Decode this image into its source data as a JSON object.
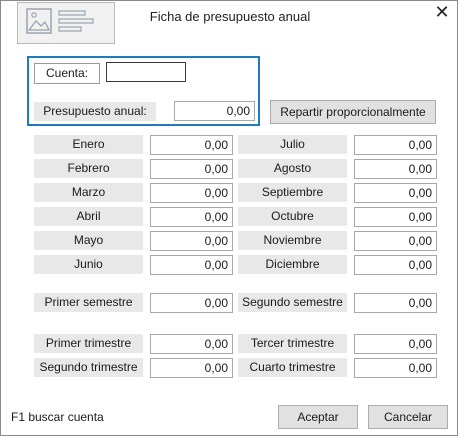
{
  "window": {
    "title": "Ficha de presupuesto anual",
    "close_glyph": "✕"
  },
  "cuenta": {
    "label": "Cuenta:",
    "value": ""
  },
  "presupuesto": {
    "label": "Presupuesto anual:",
    "value": "0,00"
  },
  "repartir_button": "Repartir proporcionalmente",
  "months": [
    {
      "label": "Enero",
      "value": "0,00"
    },
    {
      "label": "Febrero",
      "value": "0,00"
    },
    {
      "label": "Marzo",
      "value": "0,00"
    },
    {
      "label": "Abril",
      "value": "0,00"
    },
    {
      "label": "Mayo",
      "value": "0,00"
    },
    {
      "label": "Junio",
      "value": "0,00"
    },
    {
      "label": "Julio",
      "value": "0,00"
    },
    {
      "label": "Agosto",
      "value": "0,00"
    },
    {
      "label": "Septiembre",
      "value": "0,00"
    },
    {
      "label": "Octubre",
      "value": "0,00"
    },
    {
      "label": "Noviembre",
      "value": "0,00"
    },
    {
      "label": "Diciembre",
      "value": "0,00"
    }
  ],
  "semesters": [
    {
      "label": "Primer semestre",
      "value": "0,00"
    },
    {
      "label": "Segundo semestre",
      "value": "0,00"
    }
  ],
  "trimesters": [
    {
      "label": "Primer trimestre",
      "value": "0,00"
    },
    {
      "label": "Segundo trimestre",
      "value": "0,00"
    },
    {
      "label": "Tercer trimestre",
      "value": "0,00"
    },
    {
      "label": "Cuarto trimestre",
      "value": "0,00"
    }
  ],
  "footer": {
    "hint": "F1 buscar cuenta",
    "accept": "Aceptar",
    "cancel": "Cancelar"
  },
  "colors": {
    "accent": "#1f7bbf",
    "label_bg": "#e8e8e8",
    "button_bg": "#e1e1e1"
  },
  "icons": {
    "header": "form-document-icon",
    "close": "close-icon"
  }
}
